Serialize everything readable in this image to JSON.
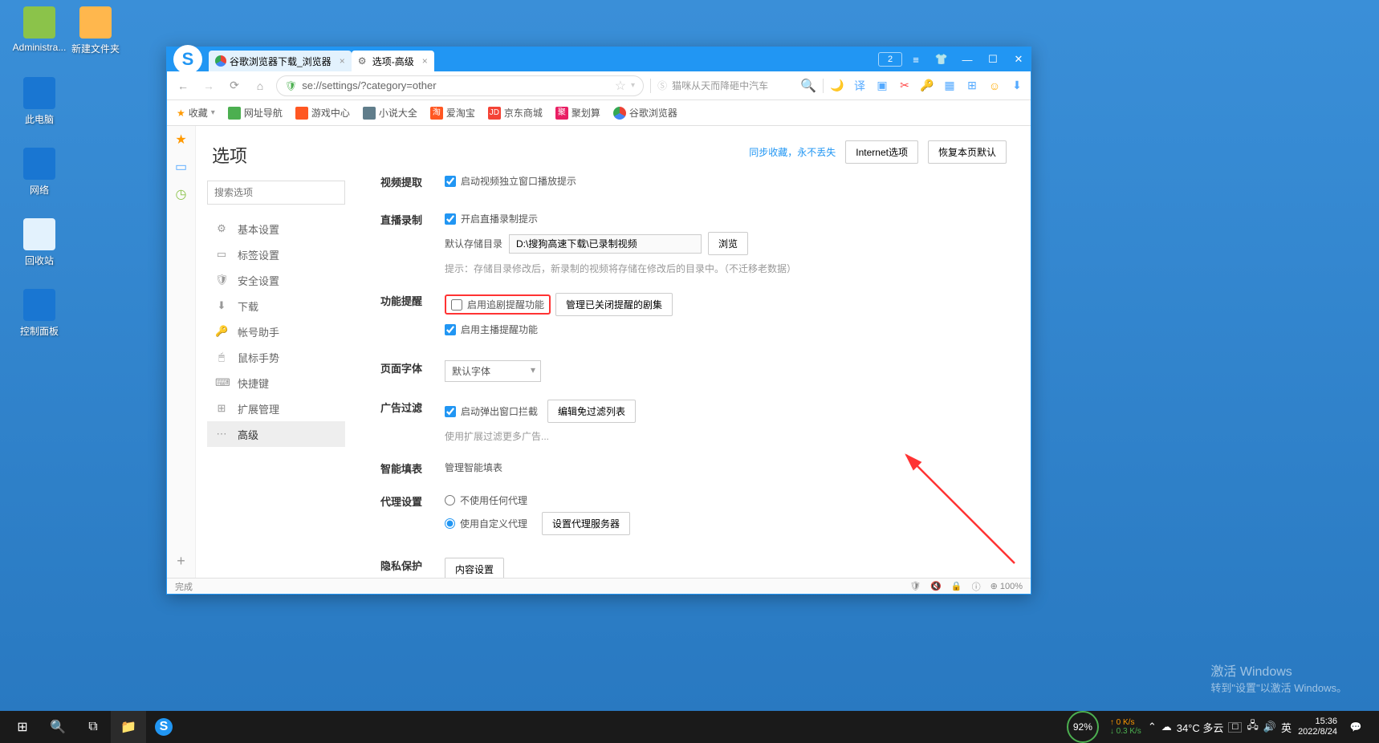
{
  "desktop": {
    "icons": [
      {
        "label": "Administra...",
        "color": "#ffcc80"
      },
      {
        "label": "新建文件夹",
        "color": "#ffb74d"
      },
      {
        "label": "此电脑",
        "color": "#42a5f5"
      },
      {
        "label": "网络",
        "color": "#42a5f5"
      },
      {
        "label": "回收站",
        "color": "#e0e0e0"
      },
      {
        "label": "控制面板",
        "color": "#42a5f5"
      }
    ]
  },
  "browser": {
    "tabs": [
      {
        "title": "谷歌浏览器下载_浏览器"
      },
      {
        "title": "选项-高级"
      }
    ],
    "url": "se://settings/?category=other",
    "search_placeholder": "猫咪从天而降砸中汽车",
    "bookmarks_label": "收藏",
    "bookmarks": [
      {
        "label": "网址导航",
        "bg": "#4caf50"
      },
      {
        "label": "游戏中心",
        "bg": "#ff5722"
      },
      {
        "label": "小说大全",
        "bg": "#607d8b"
      },
      {
        "label": "爱淘宝",
        "bg": "#ff5722"
      },
      {
        "label": "京东商城",
        "bg": "#f44336"
      },
      {
        "label": "聚划算",
        "bg": "#e91e63"
      },
      {
        "label": "谷歌浏览器",
        "bg": "#4caf50"
      }
    ]
  },
  "settings": {
    "title": "选项",
    "search_placeholder": "搜索选项",
    "sync_link": "同步收藏，永不丢失",
    "internet_btn": "Internet选项",
    "restore_btn": "恢复本页默认",
    "nav": [
      {
        "icon": "⚙",
        "label": "基本设置"
      },
      {
        "icon": "▭",
        "label": "标签设置"
      },
      {
        "icon": "🛡",
        "label": "安全设置"
      },
      {
        "icon": "⬇",
        "label": "下载"
      },
      {
        "icon": "🔑",
        "label": "帐号助手"
      },
      {
        "icon": "🖱",
        "label": "鼠标手势"
      },
      {
        "icon": "⌨",
        "label": "快捷键"
      },
      {
        "icon": "⊞",
        "label": "扩展管理"
      },
      {
        "icon": "⋯",
        "label": "高级"
      }
    ],
    "sections": {
      "video": {
        "label": "视频提取",
        "chk": "启动视频独立窗口播放提示"
      },
      "live": {
        "label": "直播录制",
        "chk": "开启直播录制提示",
        "path_lbl": "默认存储目录",
        "path": "D:\\搜狗高速下载\\已录制视频",
        "browse": "浏览",
        "hint": "提示：存储目录修改后，新录制的视频将存储在修改后的目录中。（不迁移老数据）"
      },
      "remind": {
        "label": "功能提醒",
        "chk1": "启用追剧提醒功能",
        "btn": "管理已关闭提醒的剧集",
        "chk2": "启用主播提醒功能"
      },
      "font": {
        "label": "页面字体",
        "value": "默认字体"
      },
      "adblock": {
        "label": "广告过滤",
        "chk": "启动弹出窗口拦截",
        "btn": "编辑免过滤列表",
        "hint": "使用扩展过滤更多广告..."
      },
      "autofill": {
        "label": "智能填表",
        "link": "管理智能填表"
      },
      "proxy": {
        "label": "代理设置",
        "r1": "不使用任何代理",
        "r2": "使用自定义代理",
        "btn": "设置代理服务器"
      },
      "privacy": {
        "label": "隐私保护",
        "btn": "内容设置"
      }
    }
  },
  "status": {
    "text": "完成",
    "zoom": "100%"
  },
  "watermark": {
    "t1": "激活 Windows",
    "t2": "转到\"设置\"以激活 Windows。"
  },
  "taskbar": {
    "battery": "92%",
    "net_up": "0 K/s",
    "net_dn": "0.3 K/s",
    "weather": "34°C 多云",
    "ime": "英",
    "time": "15:36",
    "date": "2022/8/24"
  },
  "window_badge": "2"
}
